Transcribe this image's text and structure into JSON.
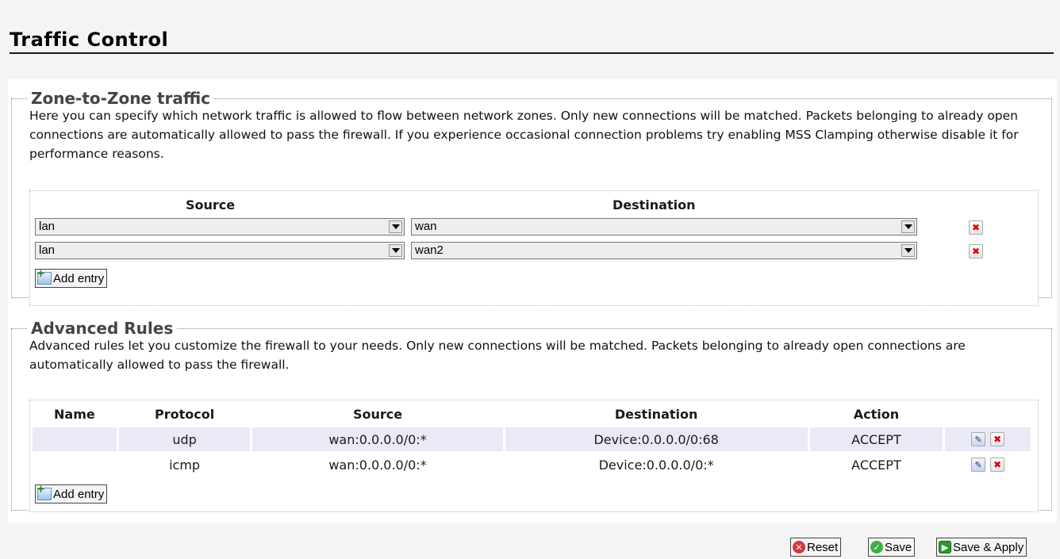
{
  "page": {
    "title": "Traffic Control"
  },
  "zone_section": {
    "legend": "Zone-to-Zone traffic",
    "description": "Here you can specify which network traffic is allowed to flow between network zones. Only new connections will be matched. Packets belonging to already open connections are automatically allowed to pass the firewall. If you experience occasional connection problems try enabling MSS Clamping otherwise disable it for performance reasons.",
    "headers": {
      "source": "Source",
      "destination": "Destination"
    },
    "rows": [
      {
        "source": "lan",
        "destination": "wan"
      },
      {
        "source": "lan",
        "destination": "wan2"
      }
    ],
    "add_label": "Add entry"
  },
  "rules_section": {
    "legend": "Advanced Rules",
    "description": "Advanced rules let you customize the firewall to your needs. Only new connections will be matched. Packets belonging to already open connections are automatically allowed to pass the firewall.",
    "headers": {
      "name": "Name",
      "protocol": "Protocol",
      "source": "Source",
      "destination": "Destination",
      "action": "Action"
    },
    "rows": [
      {
        "name": "",
        "protocol": "udp",
        "source": "wan:0.0.0.0/0:*",
        "destination": "Device:0.0.0.0/0:68",
        "action": "ACCEPT"
      },
      {
        "name": "",
        "protocol": "icmp",
        "source": "wan:0.0.0.0/0:*",
        "destination": "Device:0.0.0.0/0:*",
        "action": "ACCEPT"
      }
    ],
    "add_label": "Add entry"
  },
  "footer": {
    "reset_label": "Reset",
    "save_label": "Save",
    "save_apply_label": "Save & Apply"
  },
  "icons": {
    "delete": "delete-icon",
    "edit": "edit-icon",
    "add": "add-icon",
    "reset": "reset-icon",
    "save": "save-icon",
    "apply": "apply-icon"
  },
  "colors": {
    "odd_row": "#eaeaf7",
    "delete_red": "#dd0000",
    "page_bg": "#f4f4f4"
  }
}
